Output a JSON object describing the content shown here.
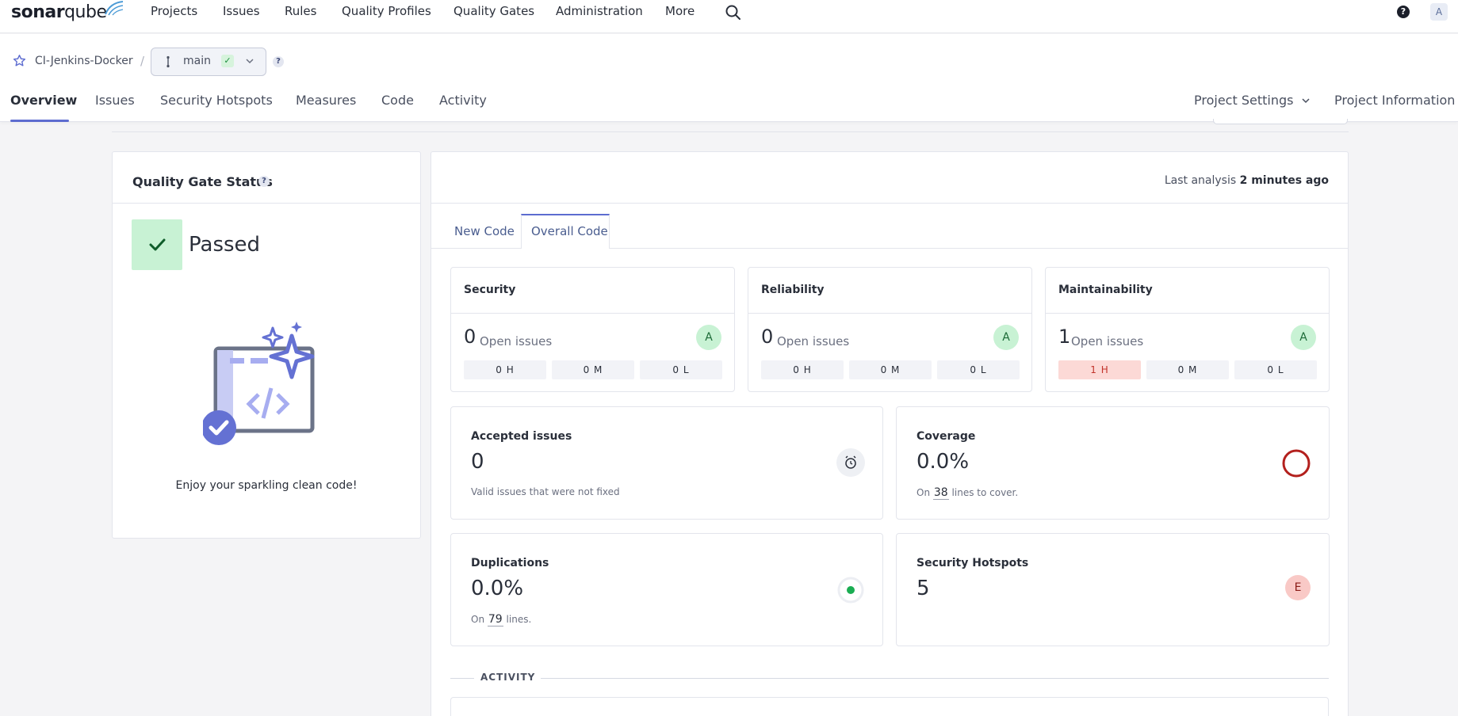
{
  "app": {
    "brand_bold": "sonar",
    "brand_light": "qube"
  },
  "nav": {
    "items": [
      "Projects",
      "Issues",
      "Rules",
      "Quality Profiles",
      "Quality Gates",
      "Administration",
      "More"
    ],
    "avatar_initial": "A",
    "help_symbol": "?"
  },
  "project": {
    "name": "CI-Jenkins-Docker",
    "separator": "/",
    "branch": "main",
    "help_symbol": "?",
    "tabs": [
      "Overview",
      "Issues",
      "Security Hotspots",
      "Measures",
      "Code",
      "Activity"
    ],
    "settings_label": "Project Settings",
    "info_label": "Project Information"
  },
  "quality_gate": {
    "title": "Quality Gate Status",
    "help_symbol": "?",
    "status": "Passed",
    "message": "Enjoy your sparkling clean code!"
  },
  "analysis": {
    "prefix": "Last analysis",
    "time": "2 minutes ago"
  },
  "code_tabs": [
    "New Code",
    "Overall Code"
  ],
  "ratings": [
    {
      "title": "Security",
      "count": "0",
      "open_label": "Open issues",
      "grade": "A",
      "severities": [
        "0 H",
        "0 M",
        "0 L"
      ]
    },
    {
      "title": "Reliability",
      "count": "0",
      "open_label": "Open issues",
      "grade": "A",
      "severities": [
        "0 H",
        "0 M",
        "0 L"
      ]
    },
    {
      "title": "Maintainability",
      "count": "1",
      "open_label": "Open issues",
      "grade": "A",
      "severities": [
        "1 H",
        "0 M",
        "0 L"
      ]
    }
  ],
  "accepted": {
    "title": "Accepted issues",
    "value": "0",
    "sub": "Valid issues that were not fixed"
  },
  "coverage": {
    "title": "Coverage",
    "value": "0.0%",
    "sub_prefix": "On",
    "lines": "38",
    "sub_suffix": "lines to cover."
  },
  "duplications": {
    "title": "Duplications",
    "value": "0.0%",
    "sub_prefix": "On",
    "lines": "79",
    "sub_suffix": "lines."
  },
  "hotspots": {
    "title": "Security Hotspots",
    "value": "5",
    "grade": "E"
  },
  "activity_heading": "ACTIVITY",
  "colors": {
    "accent": "#5d6cd0",
    "pass_green": "#c8f2d4",
    "grade_e": "#f9c9c6",
    "coverage_ring": "#b3201d"
  }
}
